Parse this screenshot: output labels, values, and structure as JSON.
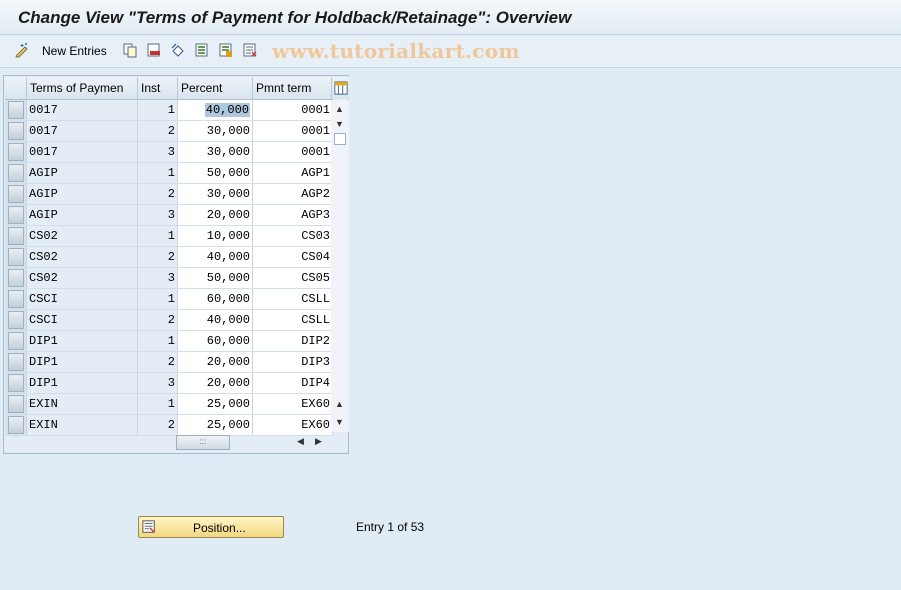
{
  "window": {
    "title": "Change View \"Terms of Payment for Holdback/Retainage\": Overview"
  },
  "toolbar": {
    "new_entries_label": "New Entries",
    "icons": [
      "display-change-icon",
      "copy-icon",
      "delete-icon",
      "undo-icon",
      "select-all-icon",
      "select-block-icon",
      "deselect-all-icon"
    ],
    "watermark": "www.tutorialkart.com"
  },
  "table": {
    "columns": [
      "Terms of Paymen",
      "Inst",
      "Percent",
      "Pmnt term"
    ],
    "rows": [
      {
        "terms": "0017",
        "inst": "1",
        "percent": "40,000",
        "pmnt": "0001"
      },
      {
        "terms": "0017",
        "inst": "2",
        "percent": "30,000",
        "pmnt": "0001"
      },
      {
        "terms": "0017",
        "inst": "3",
        "percent": "30,000",
        "pmnt": "0001"
      },
      {
        "terms": "AGIP",
        "inst": "1",
        "percent": "50,000",
        "pmnt": "AGP1"
      },
      {
        "terms": "AGIP",
        "inst": "2",
        "percent": "30,000",
        "pmnt": "AGP2"
      },
      {
        "terms": "AGIP",
        "inst": "3",
        "percent": "20,000",
        "pmnt": "AGP3"
      },
      {
        "terms": "CS02",
        "inst": "1",
        "percent": "10,000",
        "pmnt": "CS03"
      },
      {
        "terms": "CS02",
        "inst": "2",
        "percent": "40,000",
        "pmnt": "CS04"
      },
      {
        "terms": "CS02",
        "inst": "3",
        "percent": "50,000",
        "pmnt": "CS05"
      },
      {
        "terms": "CSCI",
        "inst": "1",
        "percent": "60,000",
        "pmnt": "CSLL"
      },
      {
        "terms": "CSCI",
        "inst": "2",
        "percent": "40,000",
        "pmnt": "CSLL"
      },
      {
        "terms": "DIP1",
        "inst": "1",
        "percent": "60,000",
        "pmnt": "DIP2"
      },
      {
        "terms": "DIP1",
        "inst": "2",
        "percent": "20,000",
        "pmnt": "DIP3"
      },
      {
        "terms": "DIP1",
        "inst": "3",
        "percent": "20,000",
        "pmnt": "DIP4"
      },
      {
        "terms": "EXIN",
        "inst": "1",
        "percent": "25,000",
        "pmnt": "EX60"
      },
      {
        "terms": "EXIN",
        "inst": "2",
        "percent": "25,000",
        "pmnt": "EX60"
      }
    ]
  },
  "footer": {
    "position_button": "Position...",
    "entry_info": "Entry 1 of 53"
  }
}
